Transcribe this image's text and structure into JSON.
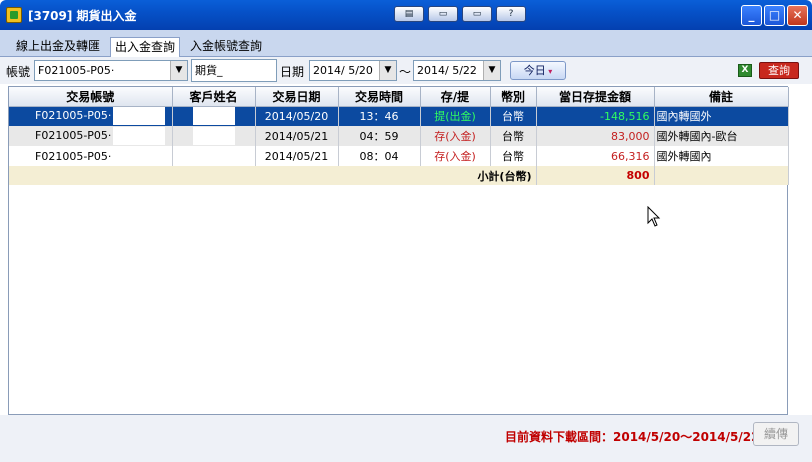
{
  "window": {
    "title": "[3709] 期貨出入金",
    "toolbar_icons": [
      "layout-icon",
      "monitor-icon",
      "window-icon",
      "help-icon"
    ],
    "toolbar_labels": [
      "▤",
      "▭",
      "▭",
      "?"
    ],
    "controls": {
      "minimize": "_",
      "maximize": "□",
      "close": "✕"
    }
  },
  "tabs": [
    {
      "label": "線上出金及轉匯"
    },
    {
      "label": "出入金查詢",
      "active": true
    },
    {
      "label": "入金帳號查詢"
    }
  ],
  "filter": {
    "account_label": "帳號",
    "account_value": "F021005-P05·",
    "type_value": "期貨_",
    "date_label": "日期",
    "date_from": "2014/ 5/20",
    "tilde": "～",
    "date_to": "2014/ 5/22",
    "today_label": "今日",
    "query_label": "查詢",
    "excel_icon": "excel-icon"
  },
  "table": {
    "headers": [
      "交易帳號",
      "客戶姓名",
      "交易日期",
      "交易時間",
      "存/提",
      "幣別",
      "當日存提金額",
      "備註"
    ],
    "rows": [
      {
        "account": "F021005-P05·",
        "name": "",
        "date": "2014/05/20",
        "time": "13：46",
        "type": "提(出金)",
        "currency": "台幣",
        "amount": "-148,516",
        "note": "國內轉國外",
        "selected": true
      },
      {
        "account": "F021005-P05·",
        "name": "",
        "date": "2014/05/21",
        "time": "04：59",
        "type": "存(入金)",
        "currency": "台幣",
        "amount": "83,000",
        "note": "國外轉國內-歐台"
      },
      {
        "account": "F021005-P05·",
        "name": "",
        "date": "2014/05/21",
        "time": "08：04",
        "type": "存(入金)",
        "currency": "台幣",
        "amount": "66,316",
        "note": "國外轉國內"
      }
    ],
    "subtotal_label": "小計(台幣)",
    "subtotal_value": "800"
  },
  "status": {
    "range_text": "目前資料下載區間：2014/5/20～2014/5/22",
    "resend_label": "續傳"
  },
  "colors": {
    "titlebar": "#0651c8",
    "selected_row": "#0c4aa0",
    "withdraw": "#1aa01a",
    "deposit": "#c42020",
    "status_text": "#c00000",
    "query_button": "#c8281e"
  }
}
